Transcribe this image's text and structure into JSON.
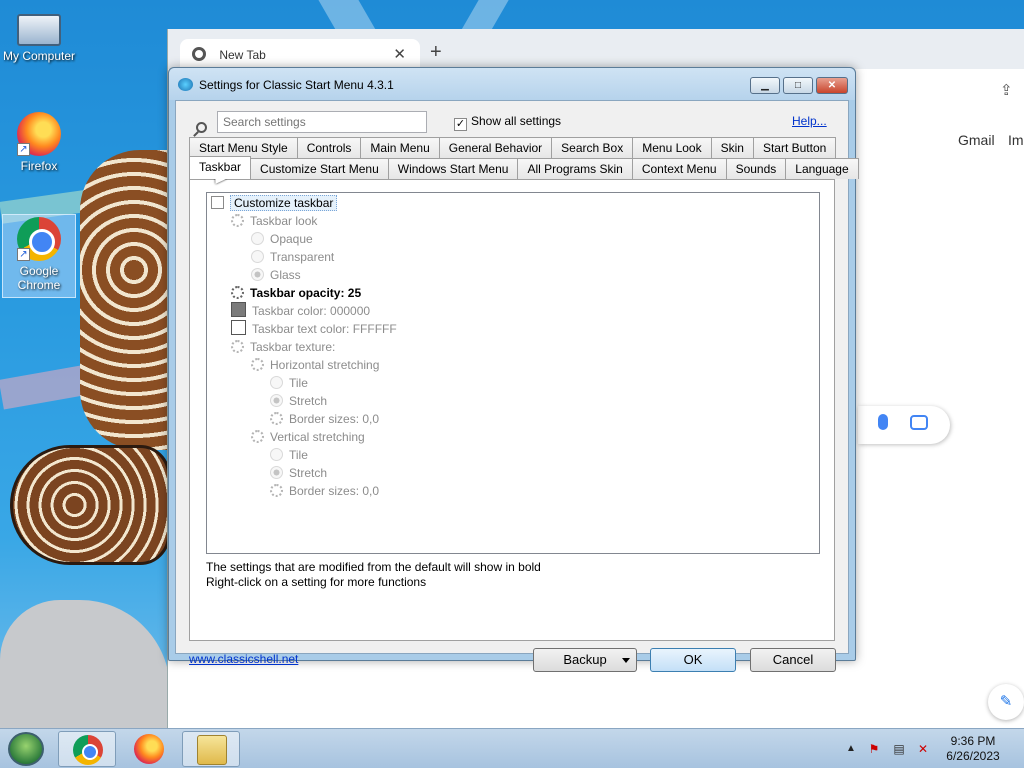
{
  "desktop": {
    "icons": [
      {
        "label": "My Computer",
        "icon": "computer-icon"
      },
      {
        "label": "Firefox",
        "icon": "firefox-icon"
      },
      {
        "label": "Google Chrome",
        "icon": "chrome-icon"
      }
    ]
  },
  "browser": {
    "tab_title": "New Tab",
    "new_tab_symbol": "+",
    "close_symbol": "✕",
    "gmail": "Gmail",
    "images": "Ima"
  },
  "dialog": {
    "title": "Settings for Classic Start Menu 4.3.1",
    "search_placeholder": "Search settings",
    "show_all_label": "Show all settings",
    "show_all_checked": true,
    "help_link": "Help...",
    "tabs_row1": [
      "Start Menu Style",
      "Controls",
      "Main Menu",
      "General Behavior",
      "Search Box",
      "Menu Look",
      "Skin",
      "Start Button"
    ],
    "tabs_row2": [
      "Taskbar",
      "Customize Start Menu",
      "Windows Start Menu",
      "All Programs Skin",
      "Context Menu",
      "Sounds",
      "Language"
    ],
    "active_tab": "Taskbar",
    "settings": {
      "customize_taskbar": "Customize taskbar",
      "taskbar_look": "Taskbar look",
      "opaque": "Opaque",
      "transparent": "Transparent",
      "glass": "Glass",
      "opacity": "Taskbar opacity: 25",
      "color": "Taskbar color: 000000",
      "text_color": "Taskbar text color: FFFFFF",
      "texture": "Taskbar texture:",
      "horizontal": "Horizontal stretching",
      "h_tile": "Tile",
      "h_stretch": "Stretch",
      "h_border": "Border sizes: 0,0",
      "vertical": "Vertical stretching",
      "v_tile": "Tile",
      "v_stretch": "Stretch",
      "v_border": "Border sizes: 0,0"
    },
    "note1": "The settings that are modified from the default will show in bold",
    "note2": "Right-click on a setting for more functions",
    "website": "www.classicshell.net",
    "backup_label": "Backup",
    "ok_label": "OK",
    "cancel_label": "Cancel"
  },
  "taskbar": {
    "time": "9:36 PM",
    "date": "6/26/2023"
  }
}
